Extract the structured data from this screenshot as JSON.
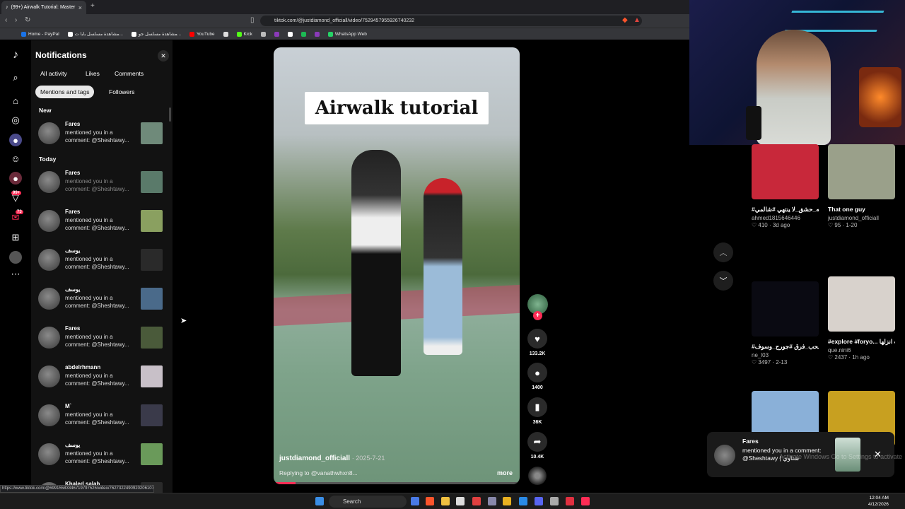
{
  "browser": {
    "tab_title": "(99+) Airwalk Tutorial: Master",
    "new_tab": "+",
    "url": "tiktok.com/@justdiamond_officiall/video/7529457955926740232",
    "bookmarks": [
      {
        "label": "Home - PayPal",
        "color": "#1a73e8"
      },
      {
        "label": "مشاهدة مسلسل بابا ت...",
        "color": "#ffffff"
      },
      {
        "label": "مشاهدة مسلسل جو...",
        "color": "#ffffff"
      },
      {
        "label": "YouTube",
        "color": "#ff0000"
      },
      {
        "label": "",
        "color": "#dddddd"
      },
      {
        "label": "Kick",
        "color": "#53fc18"
      },
      {
        "label": "",
        "color": "#bbbbbb"
      },
      {
        "label": "",
        "color": "#8a3ab9"
      },
      {
        "label": "",
        "color": "#ffffff"
      },
      {
        "label": "",
        "color": "#1db954"
      },
      {
        "label": "",
        "color": "#8a3ab9"
      },
      {
        "label": "WhatsApp Web",
        "color": "#25d366"
      }
    ]
  },
  "rail": {
    "badge_inbox": "99+",
    "badge_messages": "73"
  },
  "notifications": {
    "title": "Notifications",
    "filters": [
      "All activity",
      "Likes",
      "Comments",
      "Mentions and tags",
      "Followers"
    ],
    "active_filter": "Mentions and tags",
    "section_new": "New",
    "section_today": "Today",
    "items": [
      {
        "name": "Fares",
        "text": "mentioned you in a comment: @Sheshtawy...",
        "dim": false,
        "thumb": "#6f8a7a"
      },
      {
        "name": "Fares",
        "text": "mentioned you in a comment: @Sheshtawy...",
        "dim": true,
        "thumb": "#5a7a6a"
      },
      {
        "name": "Fares",
        "text": "mentioned you in a comment: @Sheshtawy...",
        "dim": false,
        "thumb": "#8aa060"
      },
      {
        "name": "يوسف",
        "text": "mentioned you in a comment: @Sheshtawy...",
        "dim": false,
        "thumb": "#2a2a2a"
      },
      {
        "name": "يوسف",
        "text": "mentioned you in a comment: @Sheshtawy...",
        "dim": false,
        "thumb": "#4a6a8a"
      },
      {
        "name": "Fares",
        "text": "mentioned you in a comment: @Sheshtawy...",
        "dim": false,
        "thumb": "#4a5a3a"
      },
      {
        "name": "abdelrhmann",
        "text": "mentioned you in a comment: @Sheshtawy...",
        "dim": false,
        "thumb": "#c8c0c8"
      },
      {
        "name": "M`",
        "text": "mentioned you in a comment: @Sheshtawy...",
        "dim": false,
        "thumb": "#3a3a4a"
      },
      {
        "name": "يوسف",
        "text": "mentioned you in a comment: @Sheshtawy...",
        "dim": false,
        "thumb": "#6a9a5a"
      },
      {
        "name": "Khaled salah",
        "text": "",
        "dim": false,
        "thumb": "#2a2a2a"
      }
    ]
  },
  "video": {
    "overlay_title": "Airwalk tutorial",
    "username": "justdiamond_officiall",
    "date": "2025-7-21",
    "reply": "Replying to @vanathwhxn8...",
    "more": "more",
    "progress": 0.09
  },
  "actions": {
    "likes": "133.2K",
    "comments": "1400",
    "saves": "36K",
    "shares": "10.4K"
  },
  "recommended": [
    {
      "title": "#كوره_القدم_قصه_حشق_لا ينتهي #شالمي",
      "user": "ahmed1815646446",
      "stats": "♡ 410 · 3d ago",
      "color": "#c8283a"
    },
    {
      "title": "That one guy",
      "user": "justdiamond_officiall",
      "stats": "♡ 95 · 1-20",
      "color": "#9aa08a"
    },
    {
      "title": "#اصحب_فرق #جورج_وسوف...",
      "user": "ne_l03",
      "stats": "♡ 3497 · 2-13",
      "color": "#0a0a12"
    },
    {
      "title": "#explore #foryo... حلقت انزلها 🤡",
      "user": "que.nini6",
      "stats": "♡ 2437 · 1h ago",
      "color": "#d8d2cc"
    },
    {
      "title": "",
      "user": "",
      "stats": "",
      "color": "#8ab0d8"
    },
    {
      "title": "",
      "user": "",
      "stats": "",
      "color": "#c8a020"
    }
  ],
  "toast": {
    "name": "Fares",
    "text": "mentioned you in a comment: @Sheshtawy | شتاوي",
    "watermark": "Activate Windows\nGo to Settings to activate"
  },
  "statusbar": {
    "url": "https://www.tiktok.com/@69915583346719797525/video/7627322490920206107 4"
  },
  "taskbar": {
    "search": "Search",
    "time": "12:04 AM",
    "date": "4/12/2026"
  }
}
